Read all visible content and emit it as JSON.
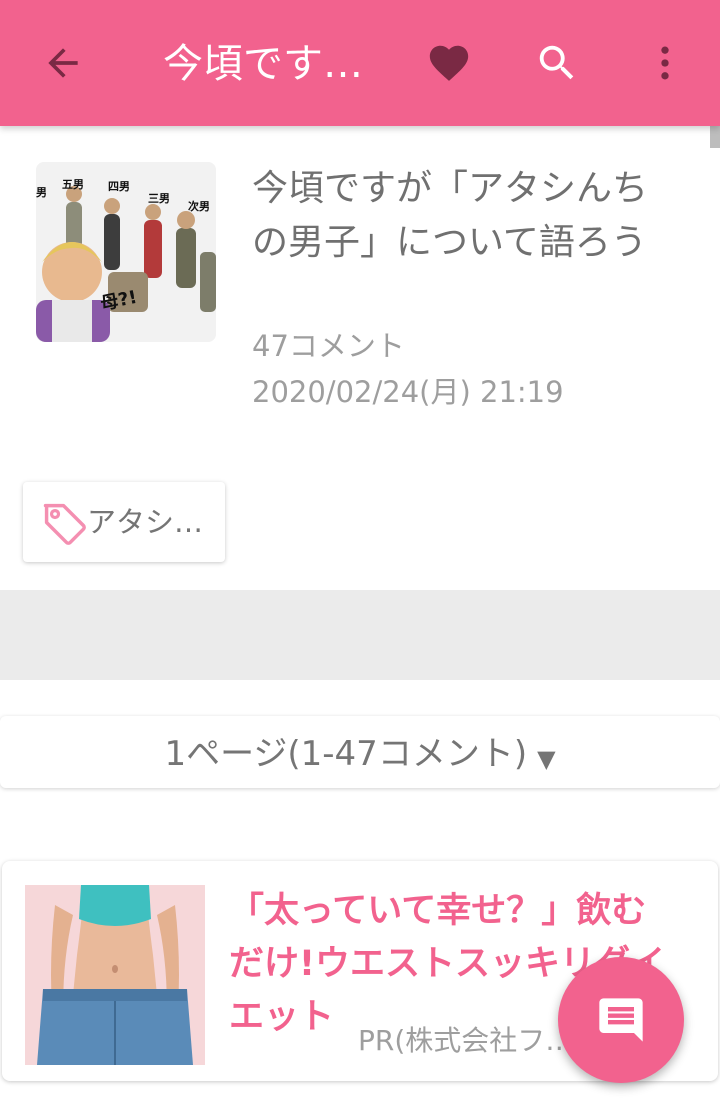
{
  "appbar": {
    "title": "今頃です…",
    "back_icon": "arrow-left-icon",
    "favorite_icon": "heart-icon",
    "search_icon": "search-icon",
    "more_icon": "more-vertical-icon",
    "background_color": "#f2628e",
    "favorite_color": "#7a2944"
  },
  "article": {
    "title": "今頃ですが「アタシんちの男子」について語ろう",
    "comment_count": "47コメント",
    "posted_at": "2020/02/24(月) 21:19",
    "thumbnail": {
      "labels": [
        "男",
        "五男",
        "四男",
        "三男",
        "次男",
        "母?!"
      ]
    }
  },
  "tags": [
    {
      "label": "アタシ…",
      "icon": "tag-icon",
      "icon_color": "#f48fb1"
    }
  ],
  "pagination": {
    "label": "1ページ(1-47コメント)",
    "dropdown_icon": "▼"
  },
  "ad": {
    "title": "「太っていて幸せ？」飲むだけ!ウエストスッキリダイエット",
    "sponsor": "PR(株式会社フ…)",
    "title_color": "#f2628e"
  },
  "fab": {
    "icon": "comment-icon"
  }
}
